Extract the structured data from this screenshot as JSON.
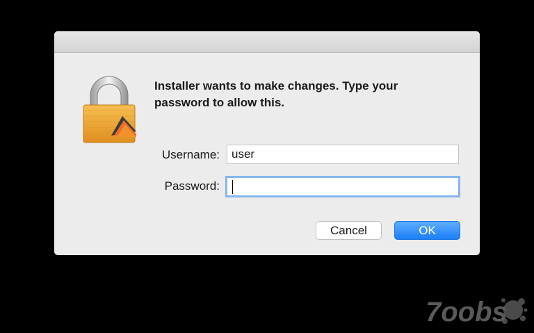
{
  "dialog": {
    "prompt": "Installer wants to make changes. Type your password to allow this.",
    "username_label": "Username:",
    "username_value": "user",
    "password_label": "Password:",
    "password_value": "",
    "cancel_label": "Cancel",
    "ok_label": "OK",
    "icon": "lock-icon"
  },
  "watermark": {
    "text": "7oobs",
    "icon": "splatter-logo"
  },
  "colors": {
    "background": "#000000",
    "dialog": "#ececec",
    "accent": "#1b7ff7",
    "focus_ring": "#86b6f0",
    "lock_gold": "#f0a83a"
  }
}
